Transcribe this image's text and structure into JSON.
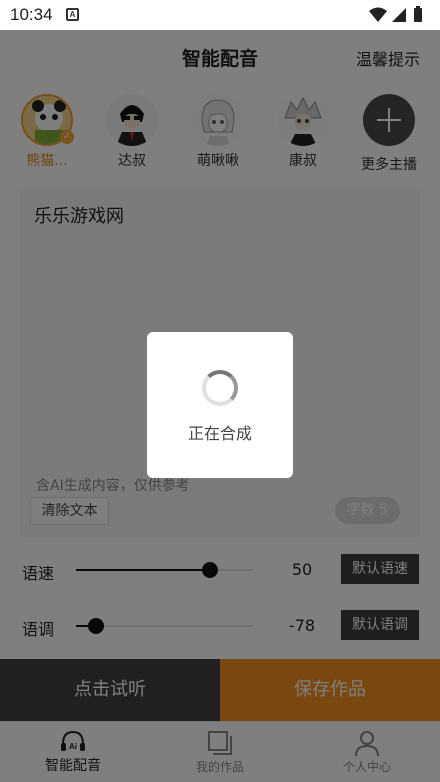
{
  "status_bar": {
    "time": "10:34",
    "notification_icon": "a-badge-icon"
  },
  "header": {
    "title": "智能配音",
    "tips": "温馨提示"
  },
  "voices": [
    {
      "name": "熊猫...",
      "selected": true
    },
    {
      "name": "达叔",
      "selected": false
    },
    {
      "name": "萌啾啾",
      "selected": false
    },
    {
      "name": "康叔",
      "selected": false
    },
    {
      "name": "更多主播",
      "selected": false
    }
  ],
  "editor": {
    "text": "乐乐游戏网",
    "ai_note": "含AI生成内容，仅供参考",
    "clear_label": "清除文本",
    "count_label": "字数 5"
  },
  "speed": {
    "label": "语速",
    "value": "50",
    "fraction": 0.75,
    "button": "默认语速"
  },
  "pitch": {
    "label": "语调",
    "value": "-78",
    "fraction": 0.11,
    "button": "默认语调"
  },
  "actions": {
    "listen": "点击试听",
    "save": "保存作品"
  },
  "tabs": [
    {
      "label": "智能配音",
      "icon": "headset-ai-icon",
      "active": true
    },
    {
      "label": "我的作品",
      "icon": "works-icon",
      "active": false
    },
    {
      "label": "个人中心",
      "icon": "user-icon",
      "active": false
    }
  ],
  "loading": {
    "text": "正在合成"
  },
  "colors": {
    "accent": "#f2901e",
    "dark_button": "#404040"
  }
}
